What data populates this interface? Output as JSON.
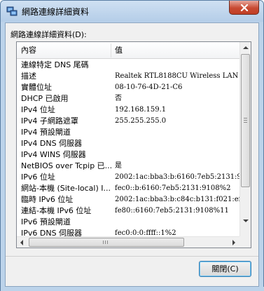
{
  "window": {
    "title": "網路連線詳細資料",
    "close_glyph": "✕"
  },
  "section_label": "網路連線詳細資料(D):",
  "list": {
    "columns": [
      "內容",
      "值"
    ],
    "rows": [
      {
        "name": "連線特定 DNS 尾碼",
        "value": ""
      },
      {
        "name": "描述",
        "value": "Realtek RTL8188CU Wireless LAN 80"
      },
      {
        "name": "實體位址",
        "value": "08-10-76-4D-21-C6"
      },
      {
        "name": "DHCP 已啟用",
        "value": "否"
      },
      {
        "name": "IPv4 位址",
        "value": "192.168.159.1"
      },
      {
        "name": "IPv4 子網路遮罩",
        "value": "255.255.255.0"
      },
      {
        "name": "IPv4 預設閘道",
        "value": ""
      },
      {
        "name": "IPv4 DNS 伺服器",
        "value": ""
      },
      {
        "name": "IPv4 WINS 伺服器",
        "value": ""
      },
      {
        "name": "NetBIOS over Tcpip 已...",
        "value": "是"
      },
      {
        "name": "IPv6 位址",
        "value": "2002:1ac:bba3:b:6160:7eb5:2131:910"
      },
      {
        "name": "網站-本機 (Site-local) I...",
        "value": "fec0::b:6160:7eb5:2131:9108%2"
      },
      {
        "name": "臨時 IPv6 位址",
        "value": "2002:1ac:bba3:b:c84c:b131:f021:ef0e"
      },
      {
        "name": "連結-本機 IPv6 位址",
        "value": "fe80::6160:7eb5:2131:9108%11"
      },
      {
        "name": "IPv6 預設閘道",
        "value": ""
      },
      {
        "name": "IPv6 DNS 伺服器",
        "value": "fec0:0:0:ffff::1%2"
      }
    ]
  },
  "buttons": {
    "close_label": "關閉(C)"
  },
  "colors": {
    "titlebar": "#bcd3ea",
    "close_red": "#c84a32",
    "focus_border": "#3c7fb1"
  }
}
